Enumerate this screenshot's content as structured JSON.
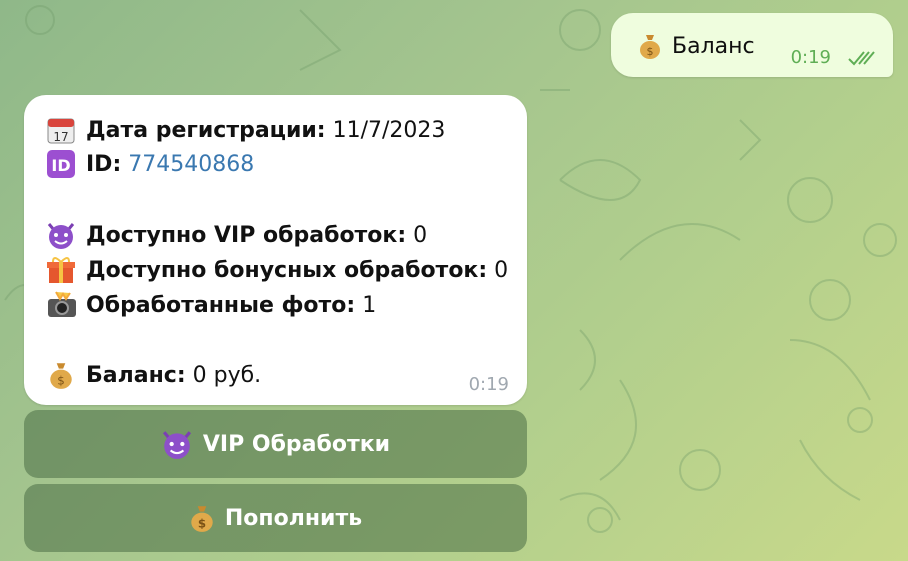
{
  "outgoing": {
    "emoji": "money-bag-icon",
    "text": "Баланс",
    "time": "0:19"
  },
  "incoming": {
    "reg_label": "Дата регистрации:",
    "reg_value": "11/7/2023",
    "id_label": "ID:",
    "id_value": "774540868",
    "vip_label": "Доступно VIP обработок:",
    "vip_value": "0",
    "bonus_label": "Доступно бонусных обработок:",
    "bonus_value": "0",
    "photos_label": "Обработанные фото:",
    "photos_value": "1",
    "balance_label": "Баланс:",
    "balance_value": "0 руб.",
    "time": "0:19"
  },
  "keyboard": {
    "vip_label": "VIP Обработки",
    "topup_label": "Пополнить"
  },
  "colors": {
    "outgoing_bg": "#effdde",
    "incoming_bg": "#ffffff",
    "link": "#3a78b0",
    "time_out": "#5fae55"
  }
}
